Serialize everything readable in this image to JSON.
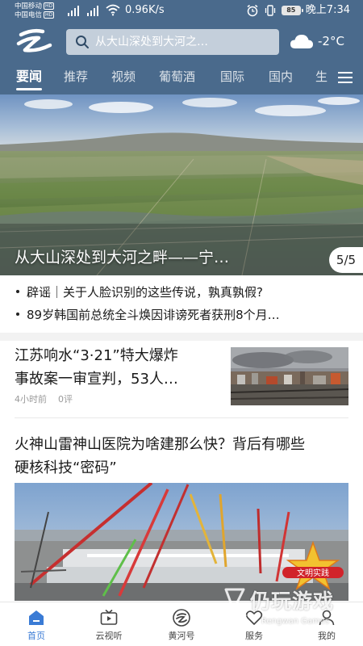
{
  "status_bar": {
    "carrier1": "中国移动",
    "carrier2": "中国电信",
    "hd_badge": "HD",
    "net_speed": "0.96K/s",
    "battery": "85",
    "time": "晚上7:34"
  },
  "search": {
    "placeholder": "从大山深处到大河之…"
  },
  "weather": {
    "icon": "cloud-icon",
    "temperature": "-2°C"
  },
  "tabs": [
    {
      "label": "要闻",
      "active": true
    },
    {
      "label": "推荐"
    },
    {
      "label": "视频"
    },
    {
      "label": "葡萄酒"
    },
    {
      "label": "国际"
    },
    {
      "label": "国内"
    },
    {
      "label": "生"
    }
  ],
  "hero": {
    "title": "从大山深处到大河之畔——宁…",
    "counter": "5/5"
  },
  "bulletins": [
    "辟谣｜关于人脸识别的这些传说，孰真孰假?",
    "89岁韩国前总统全斗焕因诽谤死者获刑8个月…"
  ],
  "articles": [
    {
      "title_line1": "江苏响水“3·21”特大爆炸",
      "title_line2": "事故案一审宣判，53人…",
      "time": "4小时前",
      "comments": "0评"
    },
    {
      "title_line1": "火神山雷神山医院为啥建那么快？背后有哪些",
      "title_line2": "硬核科技“密码”",
      "badge_text": "文明实践"
    }
  ],
  "bottom_nav": [
    {
      "label": "首页",
      "icon": "home-icon",
      "active": true
    },
    {
      "label": "云视听",
      "icon": "tv-icon"
    },
    {
      "label": "黄河号",
      "icon": "yellow-river-icon"
    },
    {
      "label": "服务",
      "icon": "heart-icon"
    },
    {
      "label": "我的",
      "icon": "user-icon"
    }
  ],
  "watermark": {
    "main": "仍玩游戏",
    "sub": "Rengwan Games"
  },
  "colors": {
    "header_bg": "#4a6a8c",
    "accent_blue": "#3a7bd5"
  }
}
